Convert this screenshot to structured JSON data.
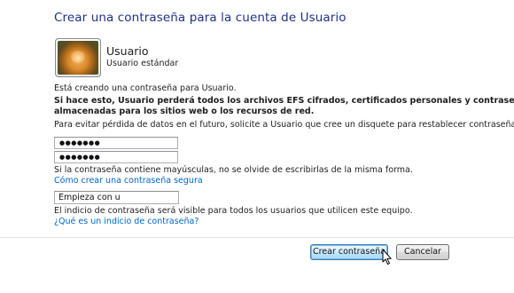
{
  "title": "Crear una contraseña para la cuenta de Usuario",
  "user": {
    "name": "Usuario",
    "account_type": "Usuario estándar"
  },
  "intro_text": "Está creando una contraseña para Usuario.",
  "warning_line1": "Si hace esto, Usuario perderá todos los archivos EFS cifrados, certificados personales y contraseñas",
  "warning_line2": "almacenadas para los sitios web o los recursos de red.",
  "advice_text": "Para evitar pérdida de datos en el futuro, solicite a Usuario que cree un disquete para restablecer contraseñas.",
  "password_field": {
    "value": "●●●●●●●"
  },
  "confirm_field": {
    "value": "●●●●●●●"
  },
  "case_note": "Si la contraseña contiene mayúsculas, no se olvide de escribirlas de la misma forma.",
  "secure_link": "Cómo crear una contraseña segura",
  "hint_field": {
    "value": "Empieza con u"
  },
  "hint_note": "El indicio de contraseña será visible para todos los usuarios que utilicen este equipo.",
  "hint_link": "¿Qué es un indicio de contraseña?",
  "buttons": {
    "create": "Crear contraseña",
    "cancel": "Cancelar"
  },
  "colors": {
    "title": "#1e3287",
    "link": "#0066cc",
    "primary_button_border": "#3c7fb1"
  }
}
